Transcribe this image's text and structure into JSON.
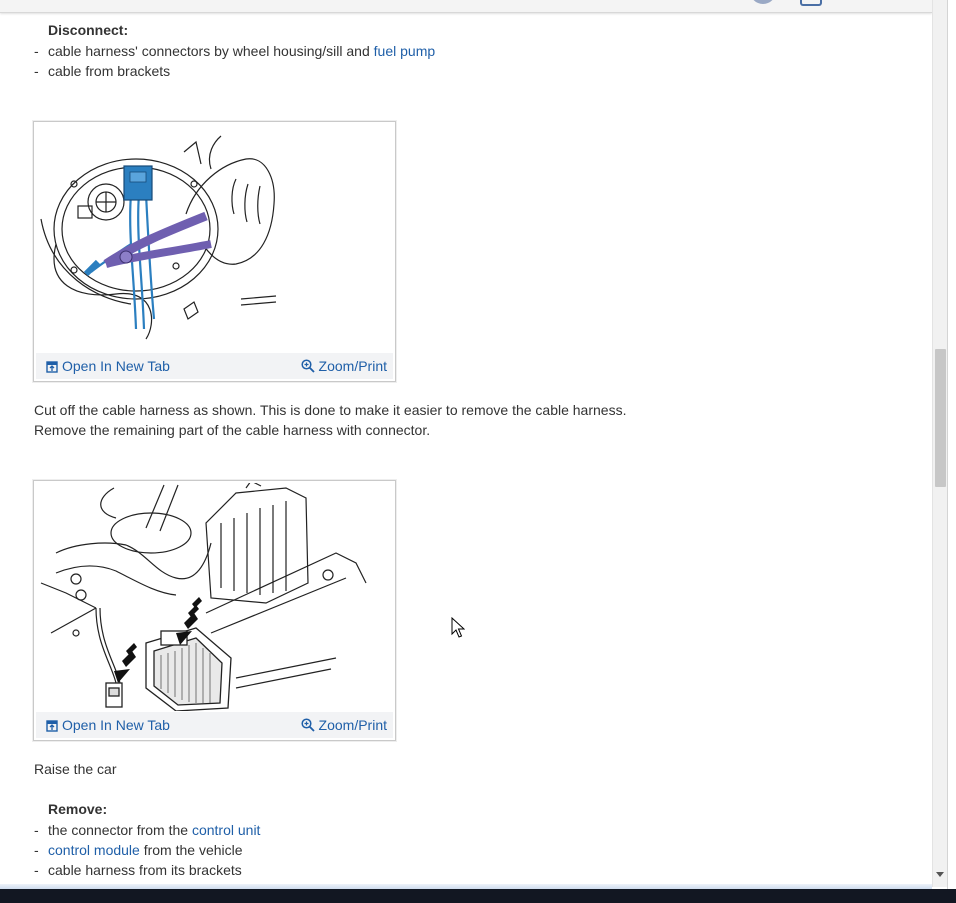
{
  "disconnect": {
    "heading": "Disconnect:",
    "items": [
      {
        "before": "cable harness' connectors by wheel housing/sill and ",
        "link": "fuel pump",
        "after": ""
      },
      {
        "before": "cable from brackets",
        "link": "",
        "after": ""
      }
    ]
  },
  "figure_actions": {
    "open_label": "Open In New Tab",
    "zoom_label": "Zoom/Print"
  },
  "cutoff": {
    "line1": "Cut off the cable harness as shown. This is done to make it easier to remove the cable harness.",
    "line2": "Remove the remaining part of the cable harness with connector."
  },
  "raise": {
    "text": "Raise the car"
  },
  "remove": {
    "heading": "Remove:",
    "items": [
      {
        "before": "the connector from the ",
        "link": "control unit",
        "after": ""
      },
      {
        "before": "",
        "link": "control module",
        "after": " from the vehicle"
      },
      {
        "before": "cable harness from its brackets",
        "link": "",
        "after": ""
      }
    ]
  },
  "colors": {
    "link": "#1f5fa8",
    "text": "#333333",
    "figure_footer": "#f2f3f5",
    "connector_blue": "#2b7fc0",
    "tool_purple": "#6f5fb0"
  },
  "icons": {
    "open": "open-in-new-tab-icon",
    "zoom": "zoom-magnifier-icon"
  }
}
